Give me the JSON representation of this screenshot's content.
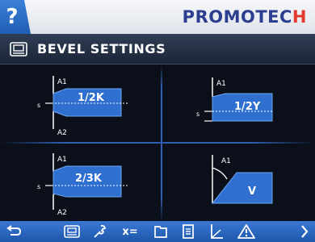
{
  "header": {
    "help_label": "?",
    "brand_main": "PROMOTEC",
    "brand_accent": "H"
  },
  "title": {
    "text": "BEVEL SETTINGS"
  },
  "bevels": [
    {
      "label": "1/2K",
      "top_marker": "A1",
      "side_marker": "s",
      "bottom_marker": "A2"
    },
    {
      "label": "1/2Y",
      "top_marker": "A1",
      "side_marker": "s"
    },
    {
      "label": "2/3K",
      "top_marker": "A1",
      "side_marker": "s",
      "bottom_marker": "A2"
    },
    {
      "label": "V",
      "top_marker": "A1"
    }
  ],
  "toolbar": {
    "items": [
      {
        "name": "back",
        "icon": "back-arrow-icon"
      },
      {
        "name": "bevel",
        "icon": "bevel-screen-icon"
      },
      {
        "name": "tools",
        "icon": "wrench-icon"
      },
      {
        "name": "variables",
        "icon": "variables-icon",
        "label": "x="
      },
      {
        "name": "files",
        "icon": "folder-icon"
      },
      {
        "name": "document",
        "icon": "document-icon"
      },
      {
        "name": "axes",
        "icon": "axes-icon"
      },
      {
        "name": "warnings",
        "icon": "warning-icon"
      },
      {
        "name": "next",
        "icon": "chevron-right-icon"
      }
    ]
  },
  "colors": {
    "accent": "#2f6fd0",
    "brand": "#2c3e8f",
    "brand_accent": "#e23b2e",
    "background": "#0a0f1a",
    "bevel_fill": "#2f6fd0"
  }
}
